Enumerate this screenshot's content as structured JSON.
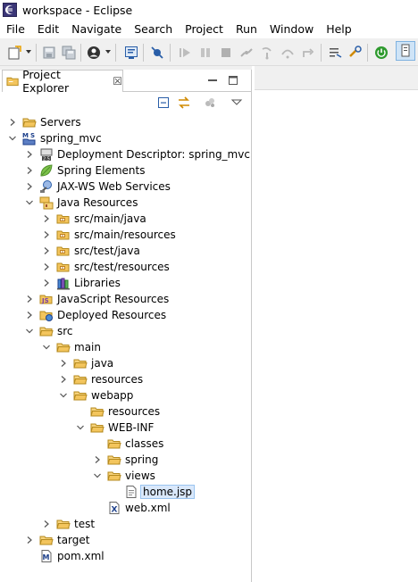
{
  "window": {
    "title": "workspace - Eclipse"
  },
  "menu": [
    "File",
    "Edit",
    "Navigate",
    "Search",
    "Project",
    "Run",
    "Window",
    "Help"
  ],
  "view": {
    "tab_label": "Project Explorer",
    "tab_close": "☒"
  },
  "tree": [
    {
      "label": "Servers",
      "depth": 0,
      "toggle": "collapsed",
      "icon": "folder-open-icon"
    },
    {
      "label": "spring_mvc",
      "depth": 0,
      "toggle": "expanded",
      "icon": "maven-web-project-icon"
    },
    {
      "label": "Deployment Descriptor: spring_mvc",
      "depth": 1,
      "toggle": "collapsed",
      "icon": "deployment-descriptor-icon"
    },
    {
      "label": "Spring Elements",
      "depth": 1,
      "toggle": "collapsed",
      "icon": "spring-leaf-icon"
    },
    {
      "label": "JAX-WS Web Services",
      "depth": 1,
      "toggle": "collapsed",
      "icon": "web-services-icon"
    },
    {
      "label": "Java Resources",
      "depth": 1,
      "toggle": "expanded",
      "icon": "java-resources-icon"
    },
    {
      "label": "src/main/java",
      "depth": 2,
      "toggle": "collapsed",
      "icon": "source-folder-icon"
    },
    {
      "label": "src/main/resources",
      "depth": 2,
      "toggle": "collapsed",
      "icon": "source-folder-icon"
    },
    {
      "label": "src/test/java",
      "depth": 2,
      "toggle": "collapsed",
      "icon": "source-folder-icon"
    },
    {
      "label": "src/test/resources",
      "depth": 2,
      "toggle": "collapsed",
      "icon": "source-folder-icon"
    },
    {
      "label": "Libraries",
      "depth": 2,
      "toggle": "collapsed",
      "icon": "libraries-icon"
    },
    {
      "label": "JavaScript Resources",
      "depth": 1,
      "toggle": "collapsed",
      "icon": "javascript-resources-icon"
    },
    {
      "label": "Deployed Resources",
      "depth": 1,
      "toggle": "collapsed",
      "icon": "deployed-resources-icon"
    },
    {
      "label": "src",
      "depth": 1,
      "toggle": "expanded",
      "icon": "folder-open-icon"
    },
    {
      "label": "main",
      "depth": 2,
      "toggle": "expanded",
      "icon": "folder-open-icon"
    },
    {
      "label": "java",
      "depth": 3,
      "toggle": "collapsed",
      "icon": "folder-open-icon"
    },
    {
      "label": "resources",
      "depth": 3,
      "toggle": "collapsed",
      "icon": "folder-open-icon"
    },
    {
      "label": "webapp",
      "depth": 3,
      "toggle": "expanded",
      "icon": "folder-open-icon"
    },
    {
      "label": "resources",
      "depth": 4,
      "toggle": "none",
      "icon": "folder-open-icon"
    },
    {
      "label": "WEB-INF",
      "depth": 4,
      "toggle": "expanded",
      "icon": "folder-open-icon"
    },
    {
      "label": "classes",
      "depth": 5,
      "toggle": "none",
      "icon": "folder-open-icon"
    },
    {
      "label": "spring",
      "depth": 5,
      "toggle": "collapsed",
      "icon": "folder-open-icon"
    },
    {
      "label": "views",
      "depth": 5,
      "toggle": "expanded",
      "icon": "folder-open-icon"
    },
    {
      "label": "home.jsp",
      "depth": 6,
      "toggle": "none",
      "icon": "jsp-file-icon",
      "selected": true
    },
    {
      "label": "web.xml",
      "depth": 5,
      "toggle": "none",
      "icon": "xml-file-icon"
    },
    {
      "label": "test",
      "depth": 2,
      "toggle": "collapsed",
      "icon": "folder-open-icon"
    },
    {
      "label": "target",
      "depth": 1,
      "toggle": "collapsed",
      "icon": "folder-open-icon"
    },
    {
      "label": "pom.xml",
      "depth": 1,
      "toggle": "none",
      "icon": "maven-pom-icon"
    }
  ],
  "colors": {
    "selection": "#d9e8fb",
    "folder": "#e8b84a",
    "toolbar_bg": "#f0f0f0"
  }
}
